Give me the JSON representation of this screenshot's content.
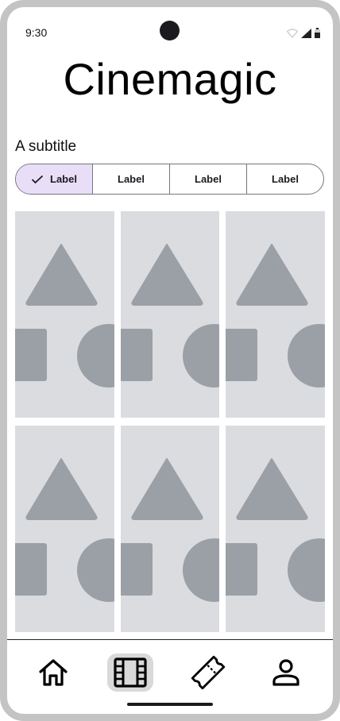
{
  "status_bar": {
    "time": "9:30",
    "icons": [
      "wifi-icon",
      "signal-icon",
      "battery-icon"
    ]
  },
  "app": {
    "title": "Cinemagic",
    "subtitle": "A subtitle"
  },
  "segments": [
    {
      "label": "Label",
      "selected": true
    },
    {
      "label": "Label",
      "selected": false
    },
    {
      "label": "Label",
      "selected": false
    },
    {
      "label": "Label",
      "selected": false
    }
  ],
  "cards": [
    {
      "image": "placeholder-image"
    },
    {
      "image": "placeholder-image"
    },
    {
      "image": "placeholder-image"
    },
    {
      "image": "placeholder-image"
    },
    {
      "image": "placeholder-image"
    },
    {
      "image": "placeholder-image"
    }
  ],
  "nav": [
    {
      "icon": "home-icon",
      "active": false
    },
    {
      "icon": "film-icon",
      "active": true
    },
    {
      "icon": "ticket-icon",
      "active": false
    },
    {
      "icon": "person-icon",
      "active": false
    }
  ],
  "colors": {
    "selected_segment": "#e8def8",
    "placeholder_bg": "#dadce0",
    "placeholder_shape": "#9aa0a6",
    "active_nav": "#d9d9d9"
  }
}
